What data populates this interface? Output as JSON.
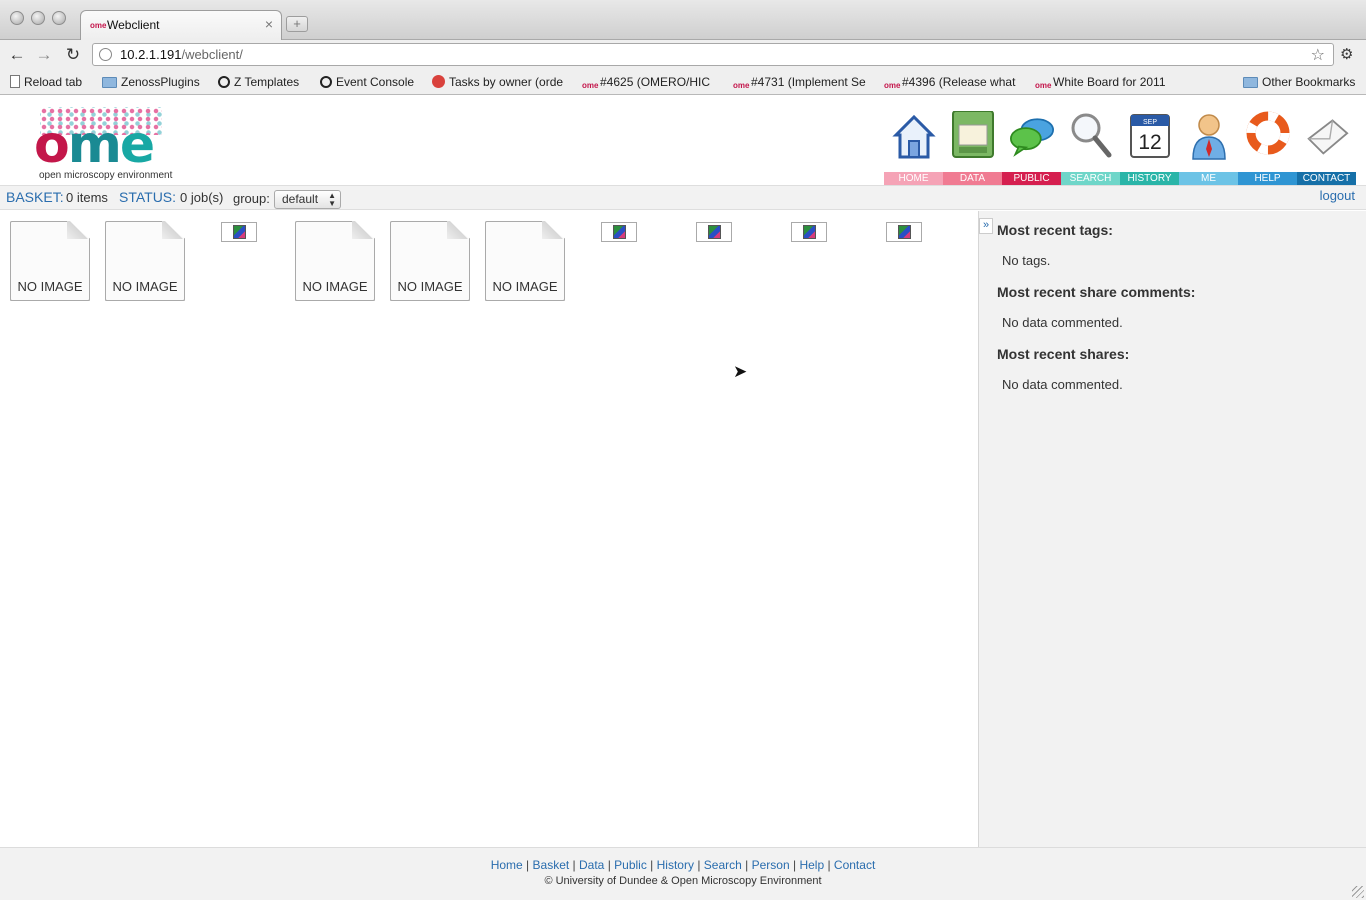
{
  "browser": {
    "tab_title": "Webclient",
    "tab_favicon": "ome",
    "tab_close": "×",
    "new_tab": "+",
    "url_host": "10.2.1.191",
    "url_path": "/webclient/",
    "bookmarks": [
      {
        "label": "Reload tab",
        "icon": "doc"
      },
      {
        "label": "ZenossPlugins",
        "icon": "folder"
      },
      {
        "label": "Z Templates",
        "icon": "ring"
      },
      {
        "label": "Event Console",
        "icon": "ring"
      },
      {
        "label": "Tasks by owner (orde",
        "icon": "bug"
      },
      {
        "label": "#4625 (OMERO/HIC",
        "icon": "ome"
      },
      {
        "label": "#4731 (Implement Se",
        "icon": "ome"
      },
      {
        "label": "#4396 (Release what",
        "icon": "ome"
      },
      {
        "label": "White Board for 2011",
        "icon": "ome"
      },
      {
        "label": "Other Bookmarks",
        "icon": "folder"
      }
    ]
  },
  "header": {
    "logo_caption": "open microscopy environment",
    "nav": [
      {
        "label": "HOME",
        "color": "#f5a3b6",
        "icon": "home-icon"
      },
      {
        "label": "DATA",
        "color": "#f07b92",
        "icon": "data-icon"
      },
      {
        "label": "PUBLIC",
        "color": "#d51f4f",
        "icon": "public-icon"
      },
      {
        "label": "SEARCH",
        "color": "#6fd6c9",
        "icon": "search-icon"
      },
      {
        "label": "HISTORY",
        "color": "#2ab5a8",
        "icon": "history-icon"
      },
      {
        "label": "ME",
        "color": "#6cc3e6",
        "icon": "me-icon"
      },
      {
        "label": "HELP",
        "color": "#2f95d3",
        "icon": "help-icon"
      },
      {
        "label": "CONTACT",
        "color": "#1670a8",
        "icon": "contact-icon"
      }
    ],
    "calendar_month": "SEP",
    "calendar_day": "12"
  },
  "statusbar": {
    "basket_label": "BASKET:",
    "basket_value": "0 items",
    "status_label": "STATUS:",
    "status_value": "0 job(s)",
    "group_label": "group:",
    "group_value": "default",
    "logout": "logout"
  },
  "content": {
    "no_image_text": "NO IMAGE",
    "thumbs": [
      {
        "type": "placeholder",
        "label": "NO IMAGE"
      },
      {
        "type": "placeholder",
        "label": "NO IMAGE"
      },
      {
        "type": "broken"
      },
      {
        "type": "placeholder",
        "label": "NO IMAGE"
      },
      {
        "type": "placeholder",
        "label": "NO IMAGE"
      },
      {
        "type": "placeholder",
        "label": "NO IMAGE"
      },
      {
        "type": "broken"
      },
      {
        "type": "broken"
      },
      {
        "type": "broken"
      },
      {
        "type": "broken"
      }
    ]
  },
  "right_panel": {
    "collapse": "»",
    "tags_heading": "Most recent tags:",
    "tags_text": "No tags.",
    "comments_heading": "Most recent share comments:",
    "comments_text": "No data commented.",
    "shares_heading": "Most recent shares:",
    "shares_text": "No data commented."
  },
  "footer": {
    "links": [
      "Home",
      "Basket",
      "Data",
      "Public",
      "History",
      "Search",
      "Person",
      "Help",
      "Contact"
    ],
    "copyright": "© University of Dundee & Open Microscopy Environment"
  }
}
